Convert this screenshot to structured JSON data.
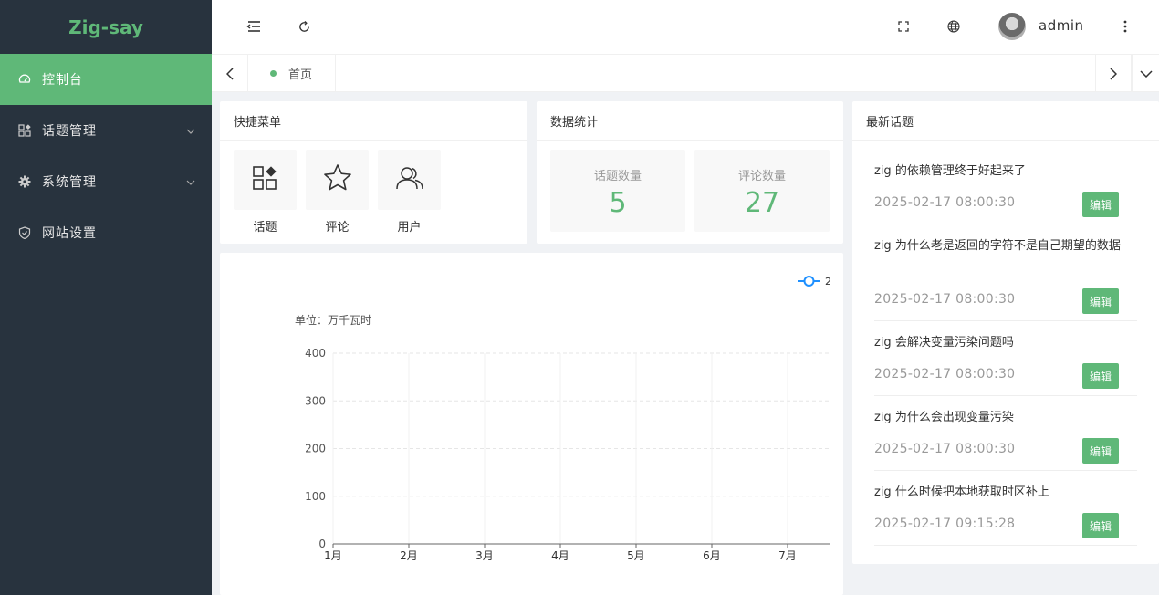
{
  "brand": {
    "name": "Zig-say"
  },
  "sidebar": {
    "items": [
      {
        "label": "控制台",
        "icon": "dashboard-icon",
        "active": true
      },
      {
        "label": "话题管理",
        "icon": "grid-icon",
        "expandable": true
      },
      {
        "label": "系统管理",
        "icon": "gear-icon",
        "expandable": true
      },
      {
        "label": "网站设置",
        "icon": "shield-icon"
      }
    ]
  },
  "header": {
    "username": "admin",
    "icons": [
      "collapse-menu-icon",
      "refresh-icon",
      "fullscreen-icon",
      "language-icon",
      "more-icon"
    ]
  },
  "tabs": {
    "home_label": "首页"
  },
  "quick_menu": {
    "title": "快捷菜单",
    "items": [
      {
        "label": "话题",
        "icon": "apps-icon"
      },
      {
        "label": "评论",
        "icon": "star-icon"
      },
      {
        "label": "用户",
        "icon": "users-icon"
      }
    ]
  },
  "stats": {
    "title": "数据统计",
    "items": [
      {
        "label": "话题数量",
        "value": "5"
      },
      {
        "label": "评论数量",
        "value": "27"
      }
    ]
  },
  "chart_data": {
    "type": "line",
    "unit_label": "单位：万千瓦时",
    "categories": [
      "1月",
      "2月",
      "3月",
      "4月",
      "5月",
      "6月",
      "7月"
    ],
    "series": [
      {
        "name": "2",
        "values": []
      }
    ],
    "ylim": [
      0,
      400
    ],
    "yticks": [
      "0",
      "100",
      "200",
      "300",
      "400"
    ],
    "grid": true,
    "legend": "top-right",
    "color": "#1e90ff"
  },
  "topics": {
    "title": "最新话题",
    "edit_label": "编辑",
    "items": [
      {
        "title": "zig 的依赖管理终于好起来了",
        "time": "2025-02-17 08:00:30"
      },
      {
        "title": "zig 为什么老是返回的字符不是自己期望的数据",
        "time": "2025-02-17 08:00:30"
      },
      {
        "title": "zig 会解决变量污染问题吗",
        "time": "2025-02-17 08:00:30"
      },
      {
        "title": "zig 为什么会出现变量污染",
        "time": "2025-02-17 08:00:30"
      },
      {
        "title": "zig 什么时候把本地获取时区补上",
        "time": "2025-02-17 09:15:28"
      }
    ]
  },
  "colors": {
    "accent": "#5fb878",
    "sidebar_bg": "#28333e",
    "chart_series": "#1e90ff"
  }
}
